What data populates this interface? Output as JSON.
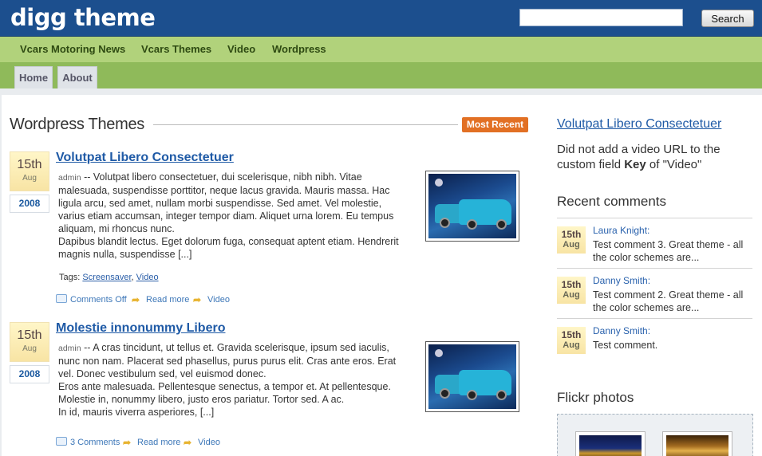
{
  "header": {
    "logo": "digg theme",
    "search_placeholder": "",
    "search_button": "Search"
  },
  "category_nav": [
    "Vcars Motoring News",
    "Vcars Themes",
    "Video",
    "Wordpress"
  ],
  "tabs": [
    "Home",
    "About"
  ],
  "main": {
    "section_title": "Wordpress Themes",
    "most_recent_label": "Most Recent",
    "posts": [
      {
        "day": "15th",
        "month": "Aug",
        "year": "2008",
        "title": "Volutpat Libero Consectetuer",
        "author": "admin",
        "body_lines": [
          " -- Volutpat libero consectetuer, dui scelerisque, nibh nibh. Vitae",
          "malesuada, suspendisse porttitor, neque lacus gravida. Mauris massa. Hac",
          "ligula arcu, sed amet, nullam morbi suspendisse. Sed amet. Vel molestie,",
          "varius etiam accumsan, integer tempor diam. Aliquet urna lorem. Eu tempus",
          "aliquam, mi rhoncus nunc.",
          "Dapibus blandit lectus. Eget dolorum fuga, consequat aptent etiam. Hendrerit",
          "magnis nulla, suspendisse [...]"
        ],
        "tags_label": "Tags:",
        "tags": [
          "Screensaver",
          "Video"
        ],
        "comments": "Comments Off",
        "read_more": "Read more",
        "video": "Video"
      },
      {
        "day": "15th",
        "month": "Aug",
        "year": "2008",
        "title": "Molestie innonummy Libero",
        "author": "admin",
        "body_lines": [
          " -- A cras tincidunt, ut tellus et. Gravida scelerisque, ipsum sed iaculis,",
          "nunc non nam. Placerat sed phasellus, purus purus elit. Cras ante eros. Erat",
          "vel. Donec vestibulum sed, vel euismod donec.",
          "Eros ante malesuada. Pellentesque senectus, a tempor et. At pellentesque.",
          "Molestie in, nonummy libero, justo eros pariatur. Tortor sed. A ac.",
          "In id, mauris viverra asperiores, [...]"
        ],
        "comments": "3 Comments",
        "read_more": "Read more",
        "video": "Video"
      }
    ]
  },
  "sidebar": {
    "video_title": "Volutpat Libero Consectetuer",
    "video_msg_pre": "Did not add a video URL to the custom field ",
    "video_msg_key": "Key",
    "video_msg_post": " of \"Video\"",
    "recent_comments_title": "Recent comments",
    "comments": [
      {
        "day": "15th",
        "month": "Aug",
        "author": "Laura Knight:",
        "line1": "Test comment 3. Great theme - all",
        "line2": "the color schemes are..."
      },
      {
        "day": "15th",
        "month": "Aug",
        "author": "Danny Smith:",
        "line1": "Test comment 2. Great theme - all",
        "line2": "the color schemes are..."
      },
      {
        "day": "15th",
        "month": "Aug",
        "author": "Danny Smith:",
        "line1": "Test comment.",
        "line2": ""
      }
    ],
    "flickr_title": "Flickr photos"
  },
  "colors": {
    "header_blue": "#1c4f8e",
    "nav_green": "#b1d27b",
    "tab_green": "#8fba5a",
    "most_recent_orange": "#e27024",
    "link_blue": "#1f5aa6"
  }
}
